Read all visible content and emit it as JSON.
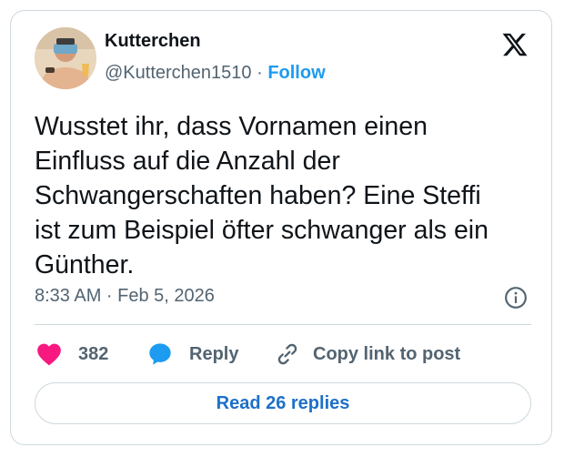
{
  "author": {
    "name": "Kutterchen",
    "handle": "@Kutterchen1510",
    "separator": " · ",
    "follow_label": "Follow"
  },
  "tweet": {
    "text": "Wusstet ihr, dass Vornamen einen\nEinfluss auf die Anzahl der\nSchwangerschaften haben? Eine Steffi\nist zum Beispiel öfter schwanger als ein\nGünther.",
    "timestamp": "8:33 AM · Feb 5, 2026"
  },
  "actions": {
    "like_count": "382",
    "reply_label": "Reply",
    "copy_label": "Copy link to post"
  },
  "read_replies_label": "Read 26 replies",
  "colors": {
    "accent": "#1d9bf0",
    "heart": "#f91880",
    "secondary_text": "#536471",
    "border": "#cfd9de"
  },
  "icons": [
    "x-logo-icon",
    "info-icon",
    "heart-icon",
    "reply-bubble-icon",
    "link-icon"
  ]
}
